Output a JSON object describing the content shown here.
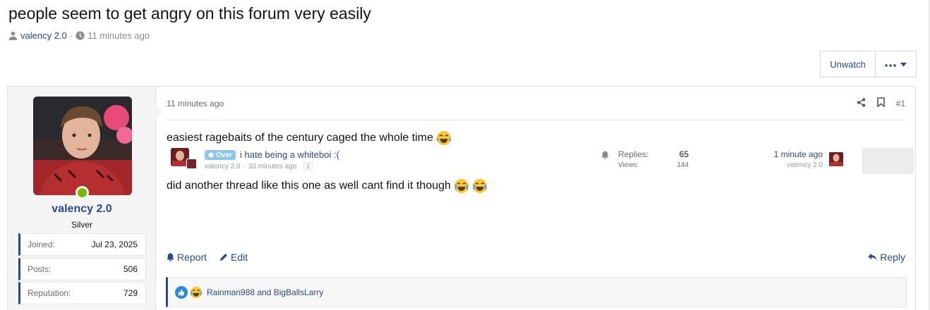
{
  "thread": {
    "title": "people seem to get angry on this forum very easily",
    "author": "valency 2.0",
    "separator": "·",
    "time": "11 minutes ago"
  },
  "actions": {
    "unwatch_label": "Unwatch"
  },
  "post": {
    "user": {
      "name": "valency 2.0",
      "rank": "Silver",
      "online": true,
      "stats": [
        {
          "label": "Joined:",
          "value": "Jul 23, 2025"
        },
        {
          "label": "Posts:",
          "value": "506"
        },
        {
          "label": "Reputation:",
          "value": "729"
        }
      ]
    },
    "time": "11 minutes ago",
    "number": "#1",
    "body_line1": "easiest ragebaits of the century caged the whole time",
    "body_line2": "did another thread like this one as well cant find it though",
    "embedded_thread": {
      "prefix": "Over",
      "title": "i hate being a whiteboi :(",
      "author": "valency 2.0",
      "time": "33 minutes ago",
      "pages": "2",
      "replies_label": "Replies:",
      "replies": "65",
      "views_label": "Views:",
      "views": "144",
      "last_time": "1 minute ago",
      "last_user": "valency 2.0"
    },
    "footer": {
      "report_label": "Report",
      "edit_label": "Edit",
      "reply_label": "Reply"
    },
    "reactions_text": "Rainman988 and BigBallsLarry"
  },
  "colors": {
    "link": "#2b4a85",
    "online": "#7ab800",
    "prefix": "#8ec6ef",
    "like": "#2e8ad8"
  },
  "icons": [
    "user-icon",
    "clock-icon",
    "ellipsis-icon",
    "caret-down-icon",
    "share-icon",
    "bookmark-icon",
    "bell-icon",
    "pencil-icon",
    "reply-icon",
    "like-reaction-icon",
    "laugh-reaction-icon",
    "laughing-tears-emoji"
  ]
}
